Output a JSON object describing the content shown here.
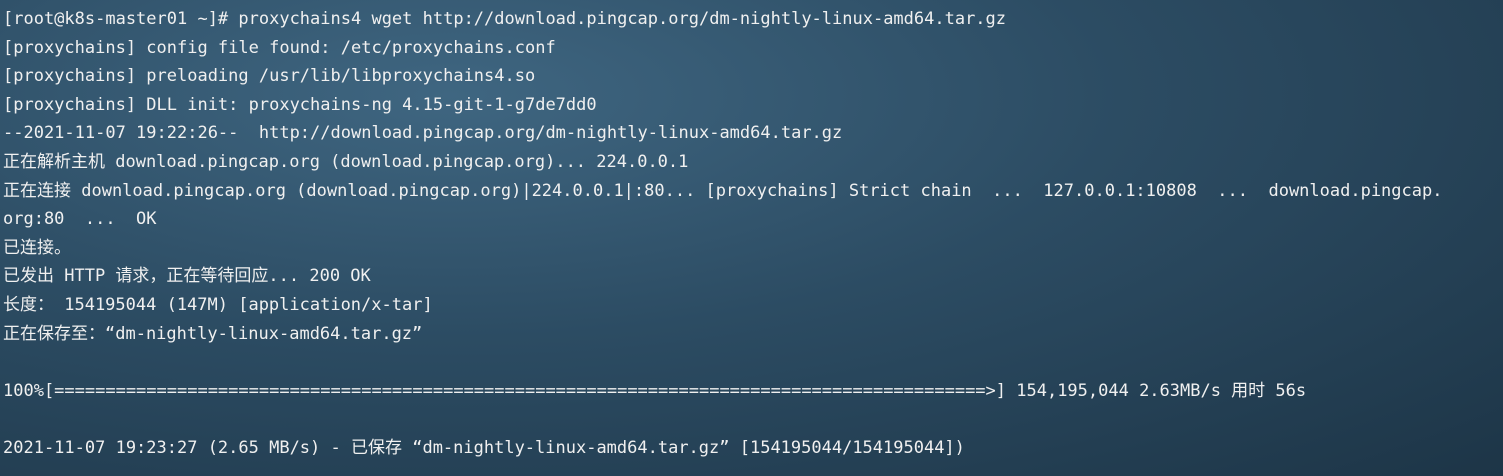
{
  "terminal": {
    "lines": [
      "[root@k8s-master01 ~]# proxychains4 wget http://download.pingcap.org/dm-nightly-linux-amd64.tar.gz",
      "[proxychains] config file found: /etc/proxychains.conf",
      "[proxychains] preloading /usr/lib/libproxychains4.so",
      "[proxychains] DLL init: proxychains-ng 4.15-git-1-g7de7dd0",
      "--2021-11-07 19:22:26--  http://download.pingcap.org/dm-nightly-linux-amd64.tar.gz",
      "正在解析主机 download.pingcap.org (download.pingcap.org)... 224.0.0.1",
      "正在连接 download.pingcap.org (download.pingcap.org)|224.0.0.1|:80... [proxychains] Strict chain  ...  127.0.0.1:10808  ...  download.pingcap.",
      "org:80  ...  OK",
      "已连接。",
      "已发出 HTTP 请求，正在等待回应... 200 OK",
      "长度： 154195044 (147M) [application/x-tar]",
      "正在保存至：“dm-nightly-linux-amd64.tar.gz”",
      "",
      "100%[===========================================================================================>] 154,195,044 2.63MB/s 用时 56s",
      "",
      "2021-11-07 19:23:27 (2.65 MB/s) - 已保存 “dm-nightly-linux-amd64.tar.gz” [154195044/154195044])"
    ]
  },
  "colors": {
    "text": "#f0f0f0",
    "background": "#2c4c63"
  }
}
